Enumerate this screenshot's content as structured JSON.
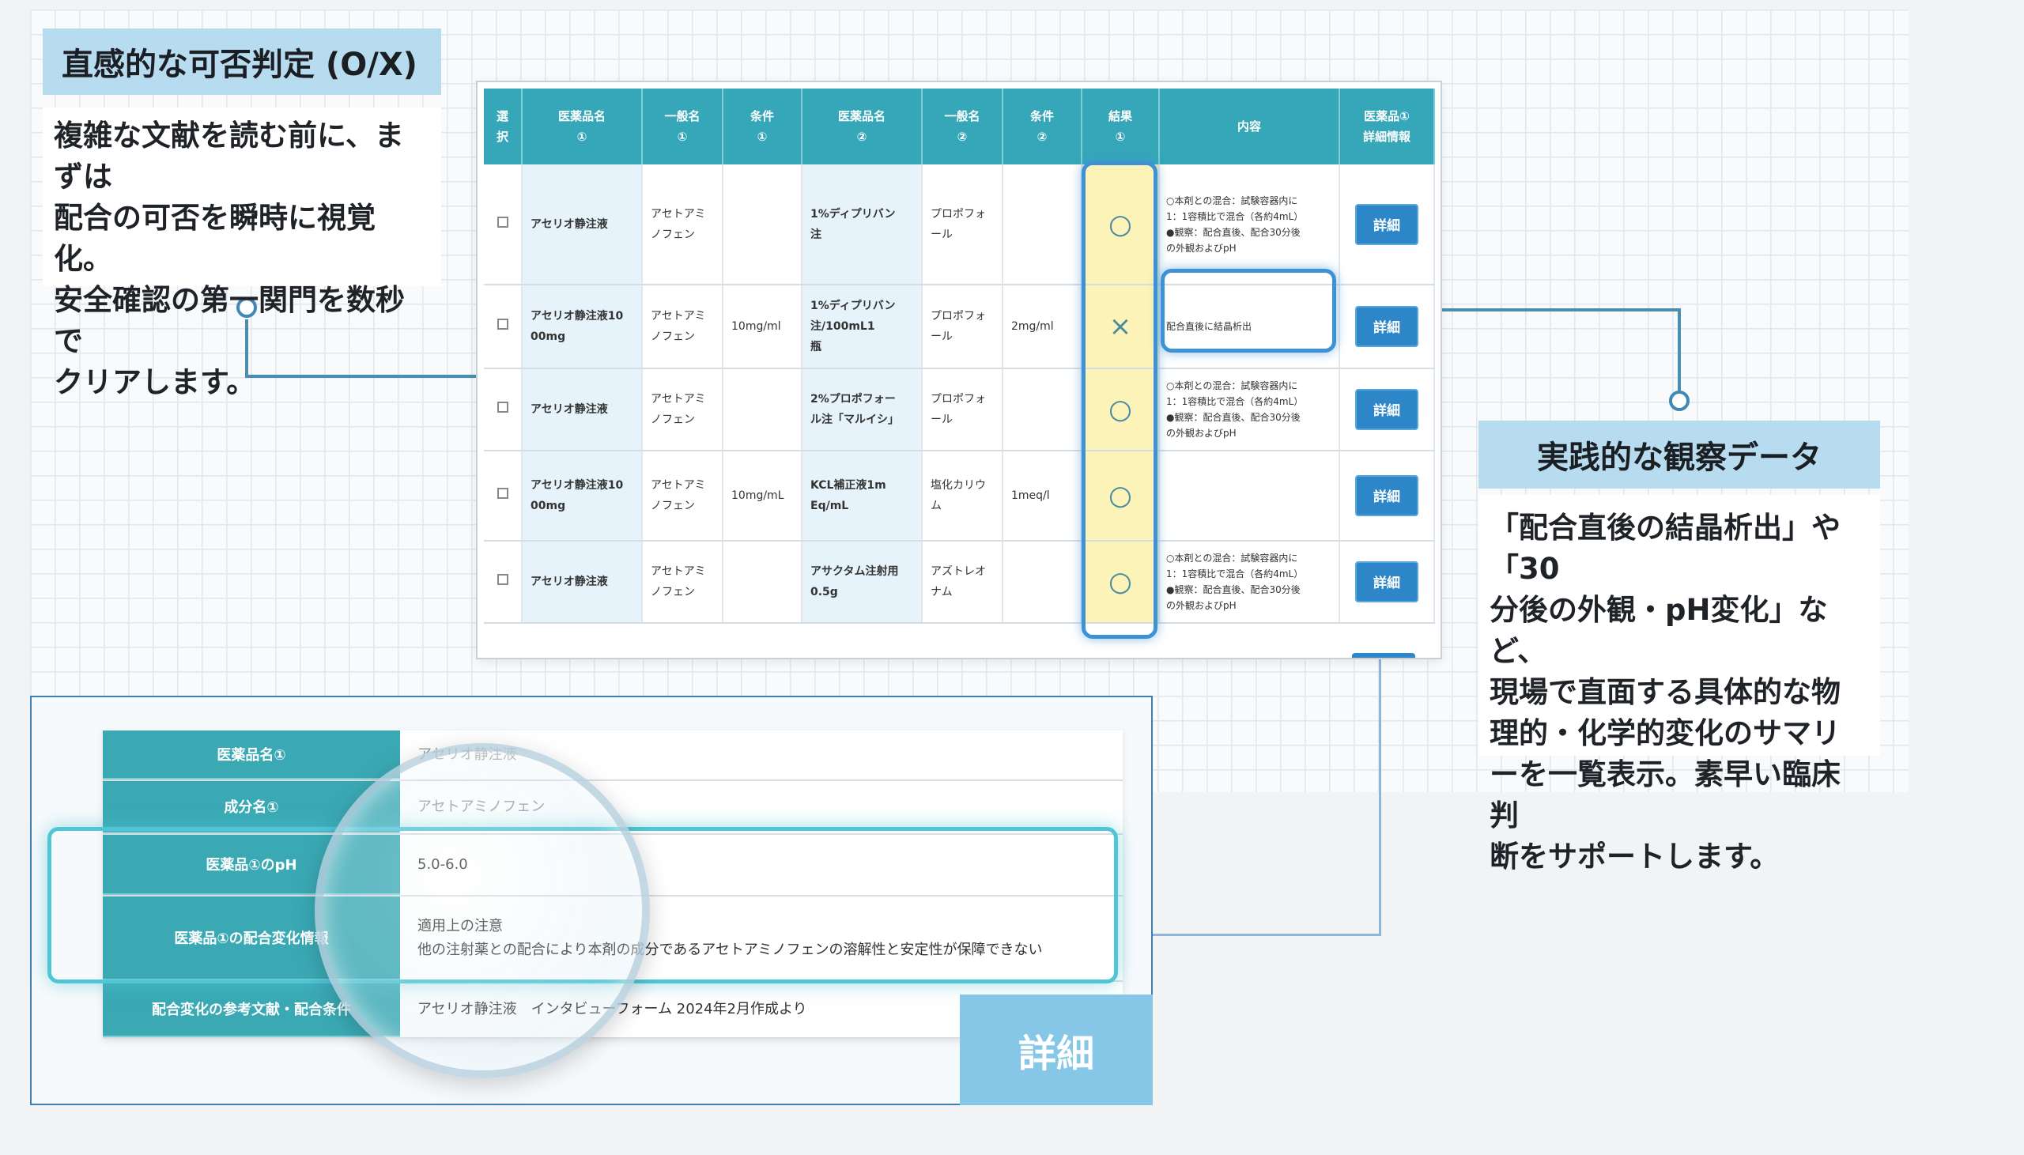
{
  "left_callout": {
    "title": "直感的な可否判定 (O/X)",
    "body": "複雑な文献を読む前に、まずは\n配合の可否を瞬時に視覚化。\n安全確認の第一関門を数秒で\nクリアします。"
  },
  "right_callout": {
    "title": "実践的な観察データ",
    "body": "「配合直後の結晶析出」や「30\n分後の外観・pH変化」など、\n現場で直面する具体的な物\n理的・化学的変化のサマリ\nーを一覧表示。素早い臨床判\n断をサポートします。"
  },
  "table": {
    "headers": [
      {
        "l1": "選",
        "l2": "択"
      },
      {
        "l1": "医薬品名",
        "l2": "①"
      },
      {
        "l1": "一般名",
        "l2": "①"
      },
      {
        "l1": "条件",
        "l2": "①"
      },
      {
        "l1": "医薬品名",
        "l2": "②"
      },
      {
        "l1": "一般名",
        "l2": "②"
      },
      {
        "l1": "条件",
        "l2": "②"
      },
      {
        "l1": "結果",
        "l2": "①"
      },
      {
        "l1": "内容",
        "l2": ""
      },
      {
        "l1": "医薬品①",
        "l2": "詳細情報"
      }
    ],
    "detail_button_label": "詳細",
    "rows": [
      {
        "drug1": "アセリオ静注液",
        "generic1": "アセトアミ\nノフェン",
        "cond1": "",
        "drug2": "1%ディプリバン\n注",
        "generic2": "プロポフォ\nール",
        "cond2": "",
        "result": "○",
        "content": "○本剤との混合：試験容器内に\n1：1容積比で混合（各約4mL）\n●観察：配合直後、配合30分後\nの外観およびpH"
      },
      {
        "drug1": "アセリオ静注液10\n00mg",
        "generic1": "アセトアミ\nノフェン",
        "cond1": "10mg/ml",
        "drug2": "1%ディプリバン\n注/100mL1\n瓶",
        "generic2": "プロポフォ\nール",
        "cond2": "2mg/ml",
        "result": "×",
        "content": "配合直後に結晶析出"
      },
      {
        "drug1": "アセリオ静注液",
        "generic1": "アセトアミ\nノフェン",
        "cond1": "",
        "drug2": "2%プロポフォー\nル注「マルイシ」",
        "generic2": "プロポフォ\nール",
        "cond2": "",
        "result": "○",
        "content": "○本剤との混合：試験容器内に\n1：1容積比で混合（各約4mL）\n●観察：配合直後、配合30分後\nの外観およびpH"
      },
      {
        "drug1": "アセリオ静注液10\n00mg",
        "generic1": "アセトアミ\nノフェン",
        "cond1": "10mg/mL",
        "drug2": "KCL補正液1m\nEq/mL",
        "generic2": "塩化カリウ\nム",
        "cond2": "1meq/l",
        "result": "○",
        "content": ""
      },
      {
        "drug1": "アセリオ静注液",
        "generic1": "アセトアミ\nノフェン",
        "cond1": "",
        "drug2": "アサクタム注射用\n0.5g",
        "generic2": "アズトレオ\nナム",
        "cond2": "",
        "result": "○",
        "content": "○本剤との混合：試験容器内に\n1：1容積比で混合（各約4mL）\n●観察：配合直後、配合30分後\nの外観およびpH"
      }
    ]
  },
  "detail": {
    "rows": [
      {
        "label": "医薬品名①",
        "value": "アセリオ静注液",
        "faded": true
      },
      {
        "label": "成分名①",
        "value": "アセトアミノフェン",
        "faded": true
      },
      {
        "label": "医薬品①のpH",
        "value": "5.0-6.0",
        "faded": false
      },
      {
        "label": "医薬品①の配合変化情報",
        "value": "適用上の注意\n他の注射薬との配合により本剤の成分であるアセトアミノフェンの溶解性と安定性が保障できない",
        "faded": false
      },
      {
        "label": "配合変化の参考文献・配合条件",
        "value": "アセリオ静注液　インタビューフォーム 2024年2月作成より",
        "faded": false
      }
    ],
    "tag_label": "詳細"
  },
  "colors": {
    "header_teal": "#35a7b8",
    "drug_cell": "#e6f3fb",
    "result_cell": "#fbf3b8",
    "highlight_blue": "#3d92d6",
    "button_blue": "#2d86c8",
    "callout_blue": "#b7dcef"
  }
}
